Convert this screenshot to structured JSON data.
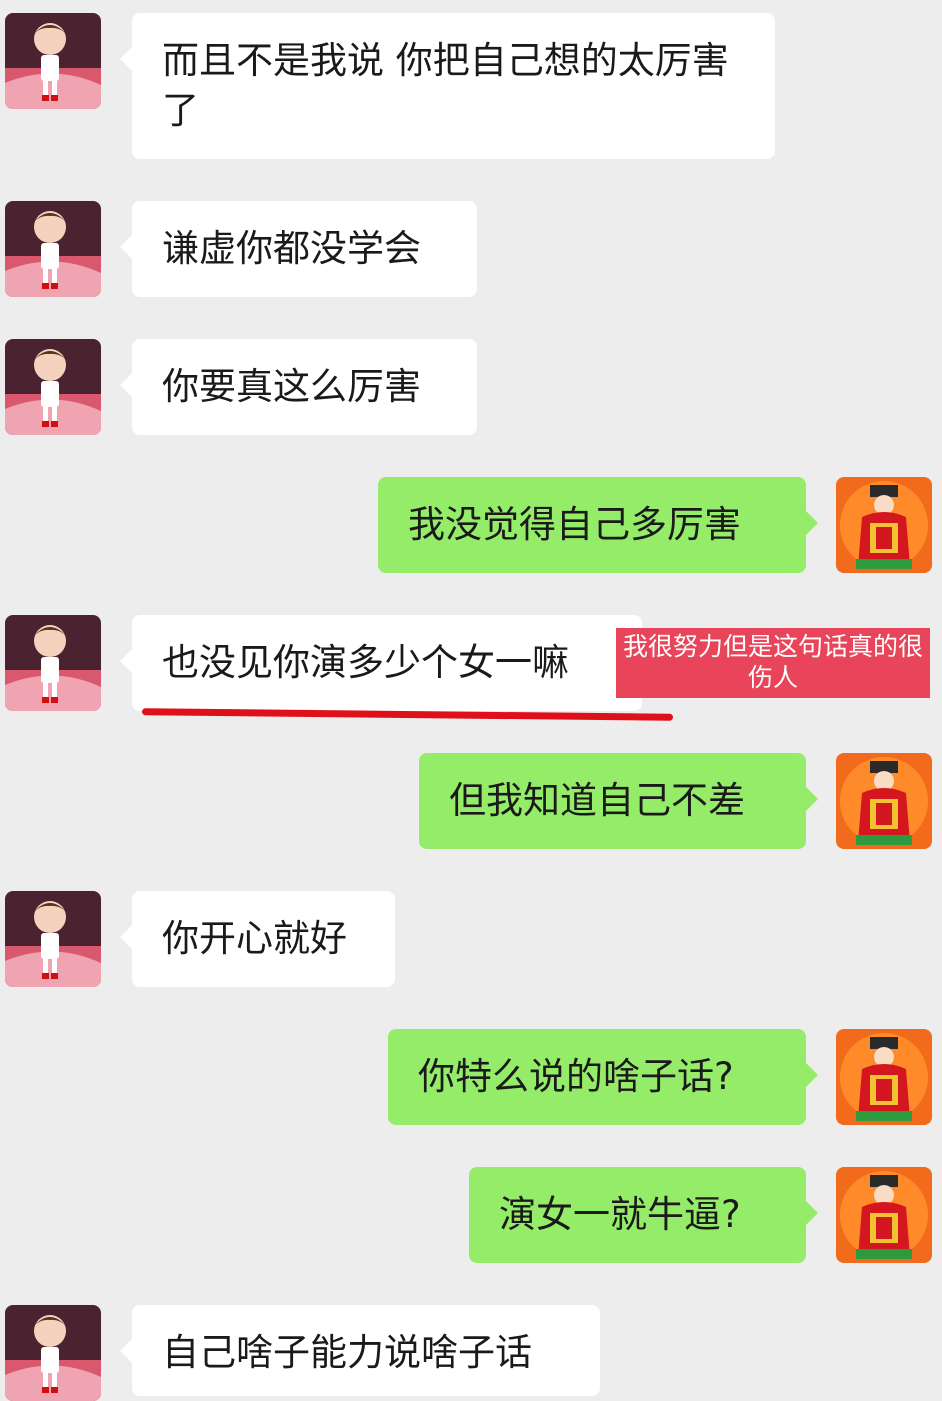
{
  "messages": [
    {
      "side": "in",
      "text": "而且不是我说 你把自己想的太厉害了"
    },
    {
      "side": "in",
      "text": "谦虚你都没学会"
    },
    {
      "side": "in",
      "text": "你要真这么厉害"
    },
    {
      "side": "out",
      "text": "我没觉得自己多厉害"
    },
    {
      "side": "in",
      "text": "也没见你演多少个女一嘛"
    },
    {
      "side": "out",
      "text": "但我知道自己不差"
    },
    {
      "side": "in",
      "text": "你开心就好"
    },
    {
      "side": "out",
      "text": "你特么说的啥子话?"
    },
    {
      "side": "out",
      "text": "演女一就牛逼?"
    },
    {
      "side": "in",
      "text": "自己啥子能力说啥子话"
    }
  ],
  "annotation": {
    "text": "我很努力但是这句话真的很伤人",
    "color": "#e8455a"
  },
  "colors": {
    "background": "#ededed",
    "incoming_bubble": "#ffffff",
    "outgoing_bubble": "#95ec69",
    "underline": "#e0101a"
  },
  "avatars": {
    "incoming": "cartoon-boy-avatar-icon",
    "outgoing": "god-of-wealth-avatar-icon"
  }
}
